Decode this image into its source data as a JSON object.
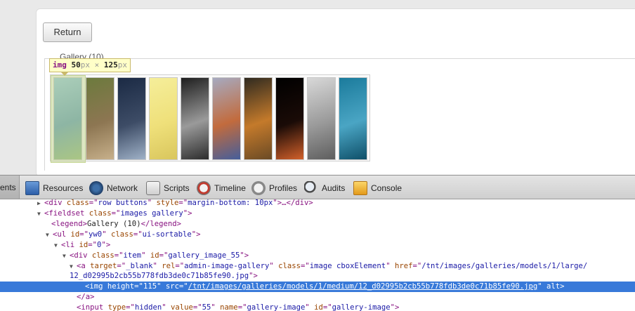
{
  "page": {
    "return_label": "Return",
    "legend": "Gallery (10)",
    "tooltip": {
      "tag": "img",
      "width": "50",
      "height": "125",
      "unit": "px",
      "times": "×"
    },
    "thumbnails": [
      {
        "name": "palm-tree",
        "colors": [
          "#8cc6e6",
          "#4b8fb6",
          "#8ab36f"
        ]
      },
      {
        "name": "statue-garden",
        "colors": [
          "#6c7a3d",
          "#8d7652",
          "#c7b08b"
        ]
      },
      {
        "name": "sports-car",
        "colors": [
          "#1b2a44",
          "#3d4c66",
          "#9fb1c7"
        ]
      },
      {
        "name": "duckling",
        "colors": [
          "#f5ee9a",
          "#efe07a",
          "#d9c65d"
        ]
      },
      {
        "name": "spiral-stairs",
        "colors": [
          "#1e1e1e",
          "#9a9a9a",
          "#2c2c2c"
        ]
      },
      {
        "name": "colorful-object",
        "colors": [
          "#a6aac0",
          "#c26b3d",
          "#455e9b"
        ]
      },
      {
        "name": "tiger",
        "colors": [
          "#2f2a20",
          "#c47a2b",
          "#6a4a25"
        ]
      },
      {
        "name": "fire-sparks",
        "colors": [
          "#000000",
          "#1a0b07",
          "#d2602a"
        ]
      },
      {
        "name": "white-tiger",
        "colors": [
          "#d8d8d8",
          "#9a9a9a",
          "#5e5e5e"
        ]
      },
      {
        "name": "water-drop",
        "colors": [
          "#1b7b9c",
          "#4aa5c4",
          "#0e4f68"
        ]
      }
    ]
  },
  "toolbar": {
    "items": [
      {
        "label": "ents",
        "icon": "elements-icon",
        "active": true
      },
      {
        "label": "Resources",
        "icon": "resources-icon"
      },
      {
        "label": "Network",
        "icon": "network-icon"
      },
      {
        "label": "Scripts",
        "icon": "scripts-icon"
      },
      {
        "label": "Timeline",
        "icon": "timeline-icon"
      },
      {
        "label": "Profiles",
        "icon": "profiles-icon"
      },
      {
        "label": "Audits",
        "icon": "audits-icon"
      },
      {
        "label": "Console",
        "icon": "console-icon"
      }
    ]
  },
  "dom": {
    "lines": [
      {
        "tri": "▶",
        "parts": [
          [
            "t",
            "<div "
          ],
          [
            "an",
            "class"
          ],
          [
            "t",
            "=\""
          ],
          [
            "av",
            "row buttons"
          ],
          [
            "t",
            "\" "
          ],
          [
            "an",
            "style"
          ],
          [
            "t",
            "=\""
          ],
          [
            "av",
            "margin-bottom: 10px"
          ],
          [
            "t",
            "\">…</div>"
          ]
        ]
      },
      {
        "tri": "▼",
        "parts": [
          [
            "t",
            "<fieldset "
          ],
          [
            "an",
            "class"
          ],
          [
            "t",
            "=\""
          ],
          [
            "av",
            "images gallery"
          ],
          [
            "t",
            "\">"
          ]
        ]
      },
      {
        "tri": "",
        "parts": [
          [
            "t",
            "<legend>"
          ],
          [
            "x",
            "Gallery (10)"
          ],
          [
            "t",
            "</legend>"
          ]
        ]
      },
      {
        "tri": "▼",
        "parts": [
          [
            "t",
            "<ul "
          ],
          [
            "an",
            "id"
          ],
          [
            "t",
            "=\""
          ],
          [
            "av",
            "yw0"
          ],
          [
            "t",
            "\" "
          ],
          [
            "an",
            "class"
          ],
          [
            "t",
            "=\""
          ],
          [
            "av",
            "ui-sortable"
          ],
          [
            "t",
            "\">"
          ]
        ]
      },
      {
        "tri": "▼",
        "parts": [
          [
            "t",
            "<li "
          ],
          [
            "an",
            "id"
          ],
          [
            "t",
            "=\""
          ],
          [
            "av",
            "0"
          ],
          [
            "t",
            "\">"
          ]
        ]
      },
      {
        "tri": "▼",
        "parts": [
          [
            "t",
            "<div "
          ],
          [
            "an",
            "class"
          ],
          [
            "t",
            "=\""
          ],
          [
            "av",
            "item"
          ],
          [
            "t",
            "\" "
          ],
          [
            "an",
            "id"
          ],
          [
            "t",
            "=\""
          ],
          [
            "av",
            "gallery_image_55"
          ],
          [
            "t",
            "\">"
          ]
        ]
      },
      {
        "tri": "▼",
        "parts": [
          [
            "t",
            "<a "
          ],
          [
            "an",
            "target"
          ],
          [
            "t",
            "=\""
          ],
          [
            "av",
            "_blank"
          ],
          [
            "t",
            "\" "
          ],
          [
            "an",
            "rel"
          ],
          [
            "t",
            "=\""
          ],
          [
            "av",
            "admin-image-gallery"
          ],
          [
            "t",
            "\" "
          ],
          [
            "an",
            "class"
          ],
          [
            "t",
            "=\""
          ],
          [
            "av",
            "image cboxElement"
          ],
          [
            "t",
            "\" "
          ],
          [
            "an",
            "href"
          ],
          [
            "t",
            "=\""
          ],
          [
            "av",
            "/tnt/images/galleries/models/1/large/"
          ]
        ]
      },
      {
        "tri": "",
        "parts": [
          [
            "av",
            "12_d02995b2cb55b778fdb3de0c71b85fe90.jpg"
          ],
          [
            "t",
            "\">"
          ]
        ]
      },
      {
        "tri": "",
        "parts": [
          [
            "t",
            "<img "
          ],
          [
            "an",
            "height"
          ],
          [
            "t",
            "=\""
          ],
          [
            "av",
            "115"
          ],
          [
            "t",
            "\" "
          ],
          [
            "an",
            "src"
          ],
          [
            "t",
            "=\""
          ],
          [
            "avu",
            "/tnt/images/galleries/models/1/medium/12_d02995b2cb55b778fdb3de0c71b85fe90.jpg"
          ],
          [
            "t",
            "\" "
          ],
          [
            "an",
            "alt"
          ],
          [
            "t",
            ">"
          ]
        ]
      },
      {
        "tri": "",
        "parts": [
          [
            "t",
            "</a>"
          ]
        ]
      },
      {
        "tri": "",
        "parts": [
          [
            "t",
            "<input "
          ],
          [
            "an",
            "type"
          ],
          [
            "t",
            "=\""
          ],
          [
            "av",
            "hidden"
          ],
          [
            "t",
            "\" "
          ],
          [
            "an",
            "value"
          ],
          [
            "t",
            "=\""
          ],
          [
            "av",
            "55"
          ],
          [
            "t",
            "\" "
          ],
          [
            "an",
            "name"
          ],
          [
            "t",
            "=\""
          ],
          [
            "av",
            "gallery-image"
          ],
          [
            "t",
            "\" "
          ],
          [
            "an",
            "id"
          ],
          [
            "t",
            "=\""
          ],
          [
            "av",
            "gallery-image"
          ],
          [
            "t",
            "\">"
          ]
        ]
      }
    ],
    "selected_index": 8
  }
}
